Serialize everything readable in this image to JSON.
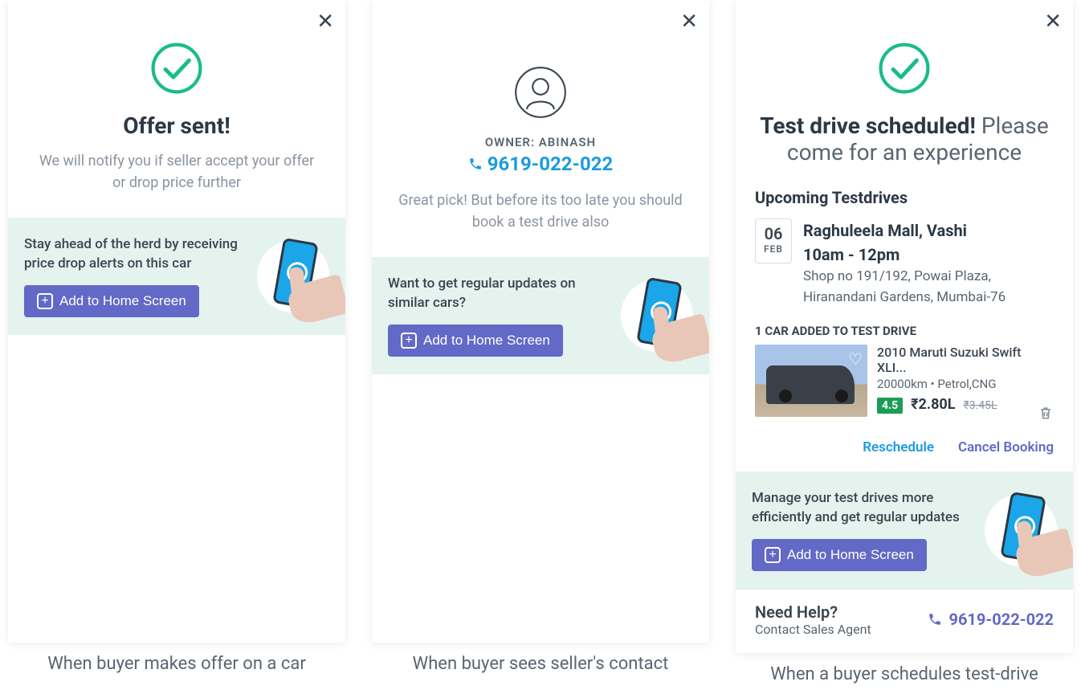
{
  "captions": {
    "a": "When buyer makes offer on a car",
    "b": "When buyer sees seller's contact",
    "c": "When a buyer schedules test-drive"
  },
  "cardA": {
    "title": "Offer sent!",
    "subtitle": "We will notify you if seller accept your offer or drop price further",
    "promo_text": "Stay ahead of the herd by receiving price drop alerts on this car",
    "button": "Add to Home Screen"
  },
  "cardB": {
    "owner_label": "OWNER: ABINASH",
    "phone": "9619-022-022",
    "subtitle": "Great pick! But before its too late you should book a test drive also",
    "promo_text": "Want to get regular updates on similar cars?",
    "button": "Add to Home Screen"
  },
  "cardC": {
    "title_bold": "Test drive scheduled!",
    "title_light": " Please come for an experience",
    "section_title": "Upcoming Testdrives",
    "date_day": "06",
    "date_month": "FEB",
    "place": "Raghuleela Mall, Vashi",
    "time": "10am - 12pm",
    "address": "Shop no 191/192, Powai Plaza, Hiranandani Gardens, Mumbai-76",
    "added_label": "1 CAR ADDED TO TEST DRIVE",
    "car": {
      "title": "2010 Maruti Suzuki Swift XLI...",
      "meta": "20000km • Petrol,CNG",
      "rating": "4.5",
      "price": "₹2.80L",
      "old_price": "₹3.45L"
    },
    "action_reschedule": "Reschedule",
    "action_cancel": "Cancel Booking",
    "promo_text": "Manage your test drives more efficiently and get regular updates",
    "button": "Add to Home Screen",
    "help_title": "Need Help?",
    "help_sub": "Contact Sales Agent",
    "help_phone": "9619-022-022"
  }
}
